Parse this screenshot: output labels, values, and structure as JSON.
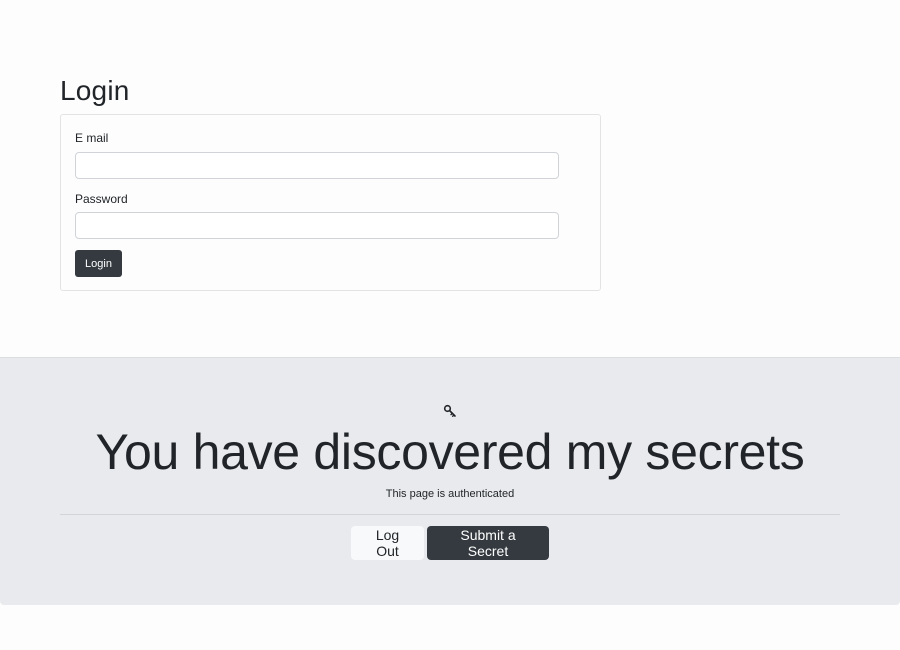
{
  "login": {
    "title": "Login",
    "email_label": "E mail",
    "email_value": "",
    "password_label": "Password",
    "password_value": "",
    "submit_label": "Login"
  },
  "hero": {
    "icon": "key-icon",
    "title": "You have discovered my secrets",
    "subtitle": "This page is authenticated",
    "logout_label": "Log Out",
    "submit_secret_label": "Submit a Secret"
  },
  "colors": {
    "dark_button": "#343a40",
    "light_button": "#f8f9fa",
    "jumbotron_bg": "#e9eaed",
    "page_bg": "#fdfdfd"
  }
}
